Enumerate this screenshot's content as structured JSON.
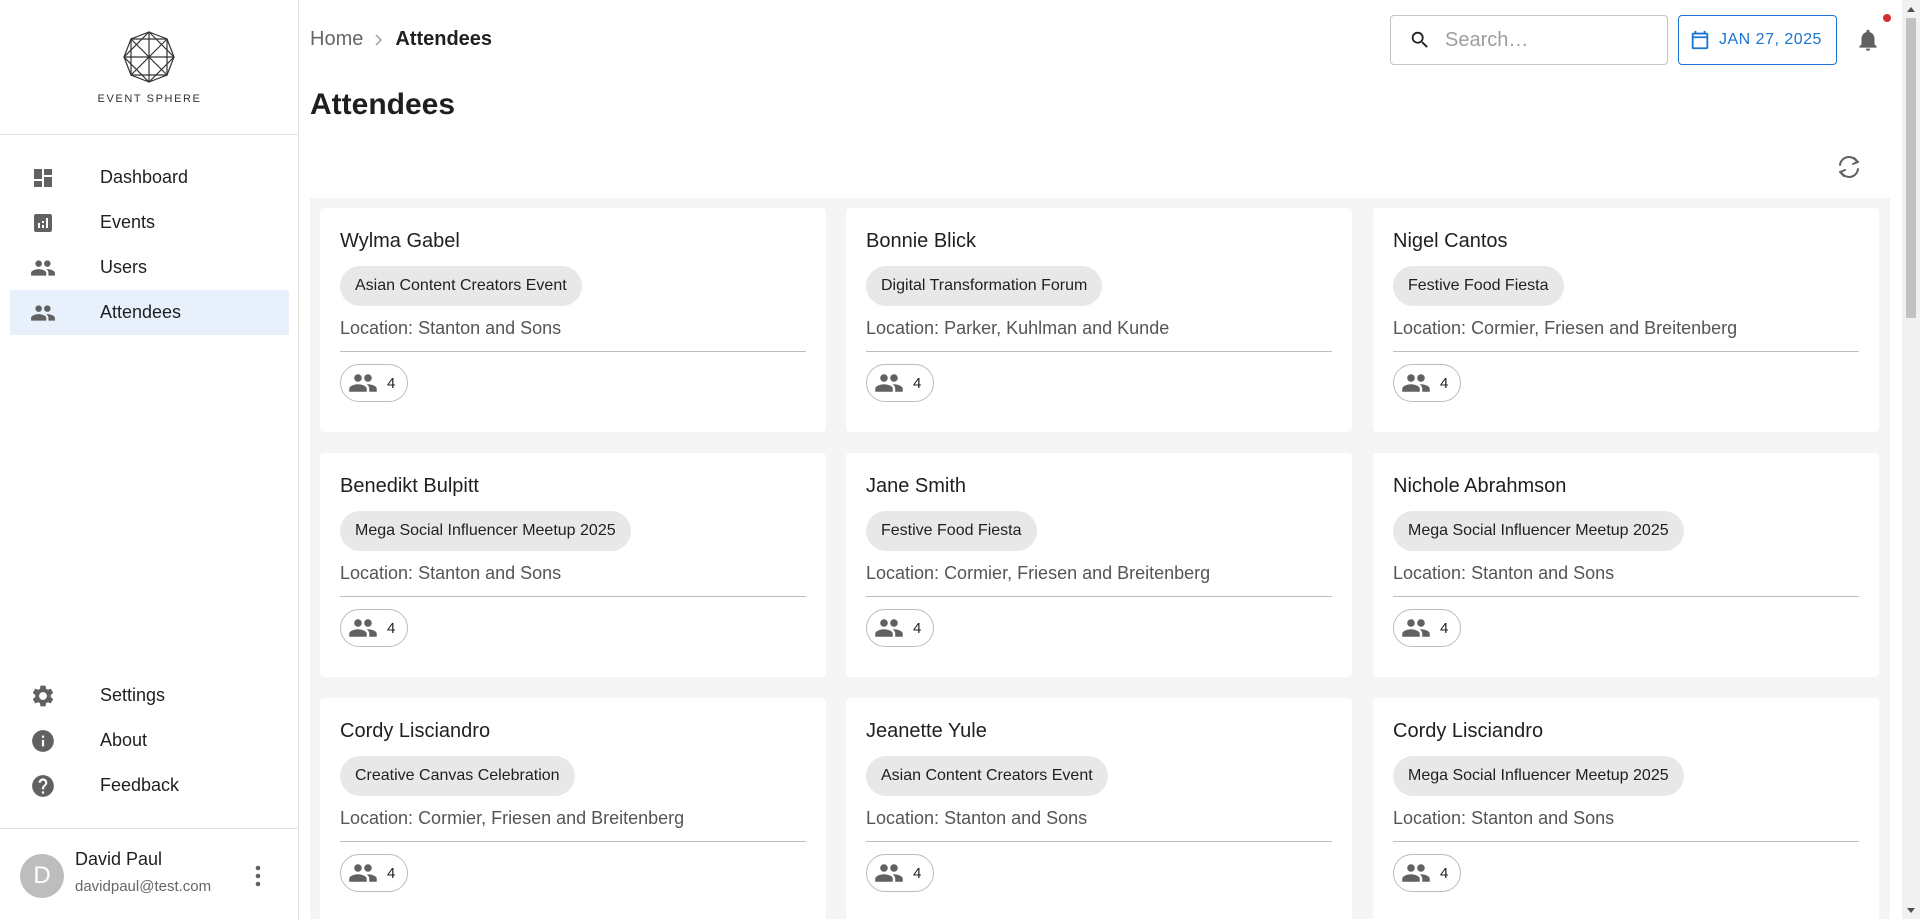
{
  "app": {
    "logo_text": "EVENT SPHERE"
  },
  "sidebar": {
    "items": [
      {
        "label": "Dashboard",
        "icon": "dashboard-icon"
      },
      {
        "label": "Events",
        "icon": "chart-icon"
      },
      {
        "label": "Users",
        "icon": "people-icon"
      },
      {
        "label": "Attendees",
        "icon": "people-icon",
        "active": true
      }
    ],
    "bottom_items": [
      {
        "label": "Settings",
        "icon": "gear-icon"
      },
      {
        "label": "About",
        "icon": "info-icon"
      },
      {
        "label": "Feedback",
        "icon": "help-icon"
      }
    ],
    "user": {
      "initial": "D",
      "name": "David Paul",
      "email": "davidpaul@test.com"
    }
  },
  "header": {
    "breadcrumb": {
      "home": "Home",
      "current": "Attendees"
    },
    "search_placeholder": "Search…",
    "date": "JAN 27, 2025"
  },
  "page_title": "Attendees",
  "location_prefix": "Location: ",
  "attendees": [
    {
      "name": "Wylma Gabel",
      "event": "Asian Content Creators Event",
      "location": "Stanton and Sons",
      "count": "4"
    },
    {
      "name": "Bonnie Blick",
      "event": "Digital Transformation Forum",
      "location": "Parker, Kuhlman and Kunde",
      "count": "4"
    },
    {
      "name": "Nigel Cantos",
      "event": "Festive Food Fiesta",
      "location": "Cormier, Friesen and Breitenberg",
      "count": "4"
    },
    {
      "name": "Benedikt Bulpitt",
      "event": "Mega Social Influencer Meetup 2025",
      "location": "Stanton and Sons",
      "count": "4"
    },
    {
      "name": "Jane Smith",
      "event": "Festive Food Fiesta",
      "location": "Cormier, Friesen and Breitenberg",
      "count": "4"
    },
    {
      "name": "Nichole Abrahmson",
      "event": "Mega Social Influencer Meetup 2025",
      "location": "Stanton and Sons",
      "count": "4"
    },
    {
      "name": "Cordy Lisciandro",
      "event": "Creative Canvas Celebration",
      "location": "Cormier, Friesen and Breitenberg",
      "count": "4"
    },
    {
      "name": "Jeanette Yule",
      "event": "Asian Content Creators Event",
      "location": "Stanton and Sons",
      "count": "4"
    },
    {
      "name": "Cordy Lisciandro",
      "event": "Mega Social Influencer Meetup 2025",
      "location": "Stanton and Sons",
      "count": "4"
    }
  ],
  "colors": {
    "accent": "#1976d2",
    "active_bg": "#e8f1fb",
    "notification": "#d32f2f"
  }
}
